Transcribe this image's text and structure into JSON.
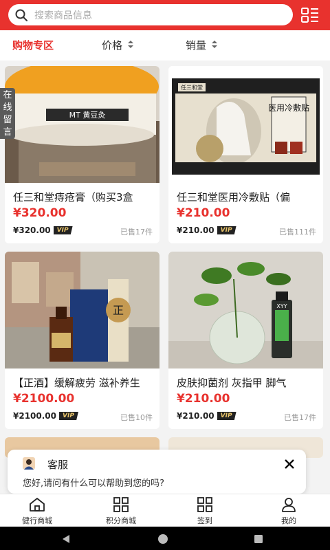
{
  "header": {
    "search_placeholder": "搜索商品信息",
    "accent_color": "#e8322e",
    "search_icon": "search-icon",
    "category_icon": "category-list-icon"
  },
  "filters": {
    "zone": "购物专区",
    "price": "价格",
    "sales": "销量"
  },
  "side_tab": "在线留言",
  "products": [
    {
      "name": "任三和堂痔疮膏（购买3盒",
      "price": "¥320.00",
      "vip_price": "¥320.00",
      "vip_badge": "VIP",
      "sold": "已售17件"
    },
    {
      "name": "任三和堂医用冷敷贴（偏",
      "price": "¥210.00",
      "vip_price": "¥210.00",
      "vip_badge": "VIP",
      "sold": "已售111件"
    },
    {
      "name": "【正酒】缓解疲劳 滋补养生",
      "price": "¥2100.00",
      "vip_price": "¥2100.00",
      "vip_badge": "VIP",
      "sold": "已售10件"
    },
    {
      "name": "皮肤抑菌剂 灰指甲 脚气",
      "price": "¥210.00",
      "vip_price": "¥210.00",
      "vip_badge": "VIP",
      "sold": "已售17件"
    }
  ],
  "product_images": {
    "p1_brand": "MT 黄豆灸",
    "p2_box_title": "医用冷敷贴",
    "p2_box_brand": "任三和堂",
    "p3_seal": "正",
    "p4_label": "XYY"
  },
  "chat": {
    "title": "客服",
    "message": "您好,请问有什么可以帮助到您的吗?"
  },
  "nav": [
    {
      "label": "健行商城",
      "icon": "home-icon"
    },
    {
      "label": "积分商城",
      "icon": "grid-icon"
    },
    {
      "label": "签到",
      "icon": "grid-icon"
    },
    {
      "label": "我的",
      "icon": "user-icon"
    }
  ]
}
